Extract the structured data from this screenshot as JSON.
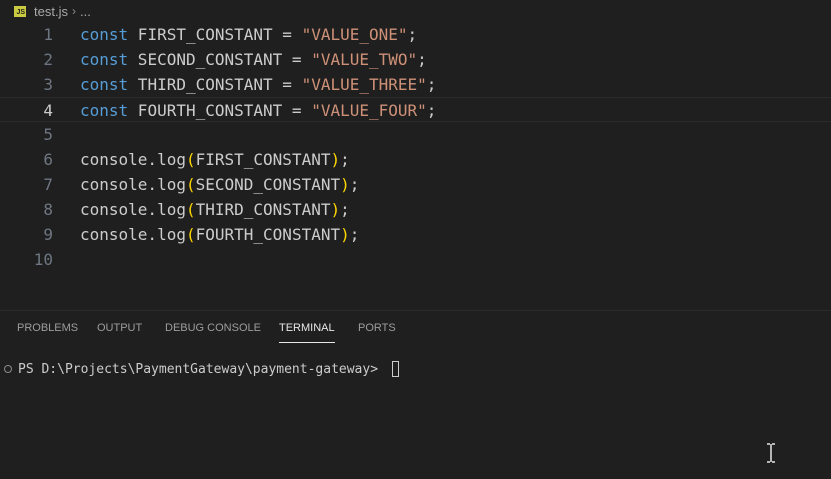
{
  "breadcrumb": {
    "file_icon_label": "JS",
    "file_name": "test.js",
    "separator": "›",
    "more": "..."
  },
  "editor": {
    "active_line": 4,
    "lines": [
      {
        "number": "1",
        "tokens": [
          {
            "t": "const",
            "c": "kw"
          },
          {
            "t": " FIRST_CONSTANT = ",
            "c": "id"
          },
          {
            "t": "\"VALUE_ONE\"",
            "c": "str"
          },
          {
            "t": ";",
            "c": "id"
          }
        ]
      },
      {
        "number": "2",
        "tokens": [
          {
            "t": "const",
            "c": "kw"
          },
          {
            "t": " SECOND_CONSTANT = ",
            "c": "id"
          },
          {
            "t": "\"VALUE_TWO\"",
            "c": "str"
          },
          {
            "t": ";",
            "c": "id"
          }
        ]
      },
      {
        "number": "3",
        "tokens": [
          {
            "t": "const",
            "c": "kw"
          },
          {
            "t": " THIRD_CONSTANT = ",
            "c": "id"
          },
          {
            "t": "\"VALUE_THREE\"",
            "c": "str"
          },
          {
            "t": ";",
            "c": "id"
          }
        ]
      },
      {
        "number": "4",
        "tokens": [
          {
            "t": "const",
            "c": "kw"
          },
          {
            "t": " FOURTH_CONSTANT = ",
            "c": "id"
          },
          {
            "t": "\"VALUE_FOUR\"",
            "c": "str"
          },
          {
            "t": ";",
            "c": "id"
          }
        ]
      },
      {
        "number": "5",
        "tokens": []
      },
      {
        "number": "6",
        "tokens": [
          {
            "t": "console.log",
            "c": "id"
          },
          {
            "t": "(",
            "c": "br"
          },
          {
            "t": "FIRST_CONSTANT",
            "c": "id"
          },
          {
            "t": ")",
            "c": "br"
          },
          {
            "t": ";",
            "c": "id"
          }
        ]
      },
      {
        "number": "7",
        "tokens": [
          {
            "t": "console.log",
            "c": "id"
          },
          {
            "t": "(",
            "c": "br"
          },
          {
            "t": "SECOND_CONSTANT",
            "c": "id"
          },
          {
            "t": ")",
            "c": "br"
          },
          {
            "t": ";",
            "c": "id"
          }
        ]
      },
      {
        "number": "8",
        "tokens": [
          {
            "t": "console.log",
            "c": "id"
          },
          {
            "t": "(",
            "c": "br"
          },
          {
            "t": "THIRD_CONSTANT",
            "c": "id"
          },
          {
            "t": ")",
            "c": "br"
          },
          {
            "t": ";",
            "c": "id"
          }
        ]
      },
      {
        "number": "9",
        "tokens": [
          {
            "t": "console.log",
            "c": "id"
          },
          {
            "t": "(",
            "c": "br"
          },
          {
            "t": "FOURTH_CONSTANT",
            "c": "id"
          },
          {
            "t": ")",
            "c": "br"
          },
          {
            "t": ";",
            "c": "id"
          }
        ]
      },
      {
        "number": "10",
        "tokens": []
      }
    ]
  },
  "panel": {
    "tabs": [
      {
        "label": "PROBLEMS",
        "active": false
      },
      {
        "label": "OUTPUT",
        "active": false
      },
      {
        "label": "DEBUG CONSOLE",
        "active": false
      },
      {
        "label": "TERMINAL",
        "active": true
      },
      {
        "label": "PORTS",
        "active": false
      }
    ],
    "terminal": {
      "prompt": "PS D:\\Projects\\PaymentGateway\\payment-gateway> "
    }
  },
  "colors": {
    "background": "#1f1f1f",
    "keyword": "#569cd6",
    "string": "#ce9178",
    "bracket": "#ffd700",
    "text": "#cccccc",
    "line_number": "#6e7681"
  },
  "icons": [
    "js-file-icon",
    "chevron-right-icon",
    "terminal-status-circle-icon",
    "text-cursor-icon"
  ]
}
